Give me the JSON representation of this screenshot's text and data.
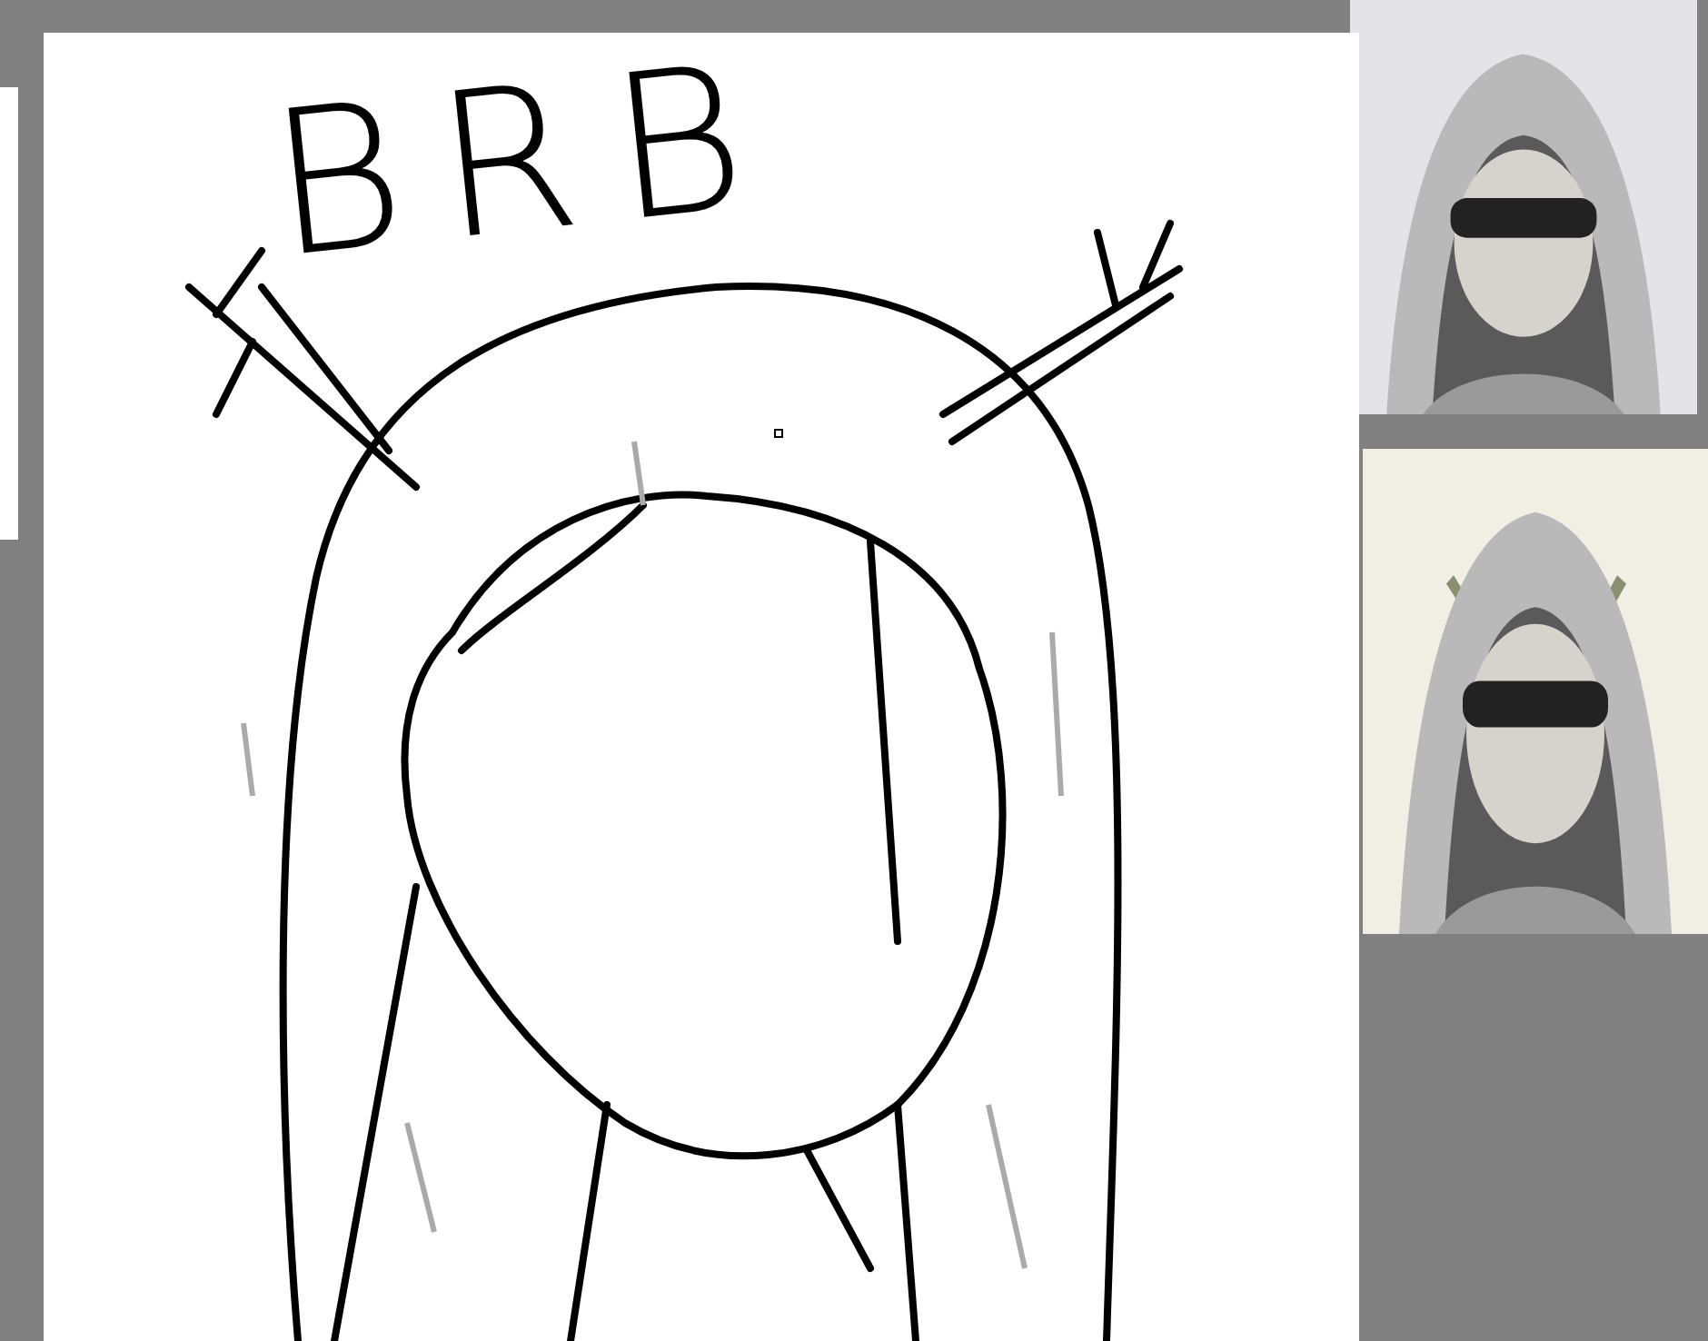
{
  "canvas": {
    "text": "BRB"
  }
}
